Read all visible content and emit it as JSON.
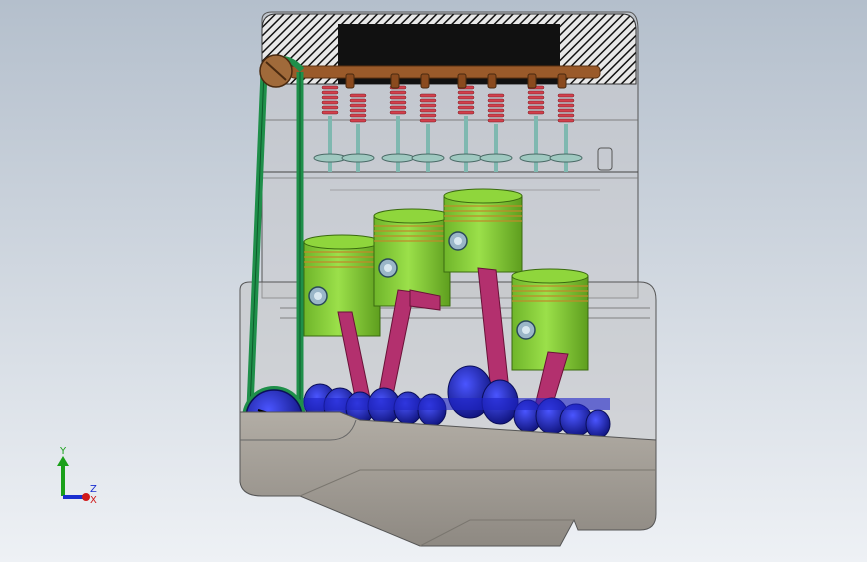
{
  "view": {
    "background_top": "#b4bfcc",
    "background_bottom": "#eef1f5"
  },
  "triad": {
    "y_label": "Y",
    "z_label": "Z",
    "x_label": "X",
    "y_color": "#1aa01a",
    "z_color": "#1a2fd0",
    "x_color": "#d01a1a"
  },
  "colors": {
    "piston": "#8fd63c",
    "piston_dark": "#5e9e1e",
    "rod": "#b3306e",
    "crank": "#1e23c8",
    "crank_dark": "#0e127a",
    "belt": "#1f8f4a",
    "spring": "#d2404c",
    "valve_stem": "#7fb8b0",
    "camshaft": "#9a5a2a",
    "sump": "#a49f97",
    "hatch": "#111111"
  }
}
